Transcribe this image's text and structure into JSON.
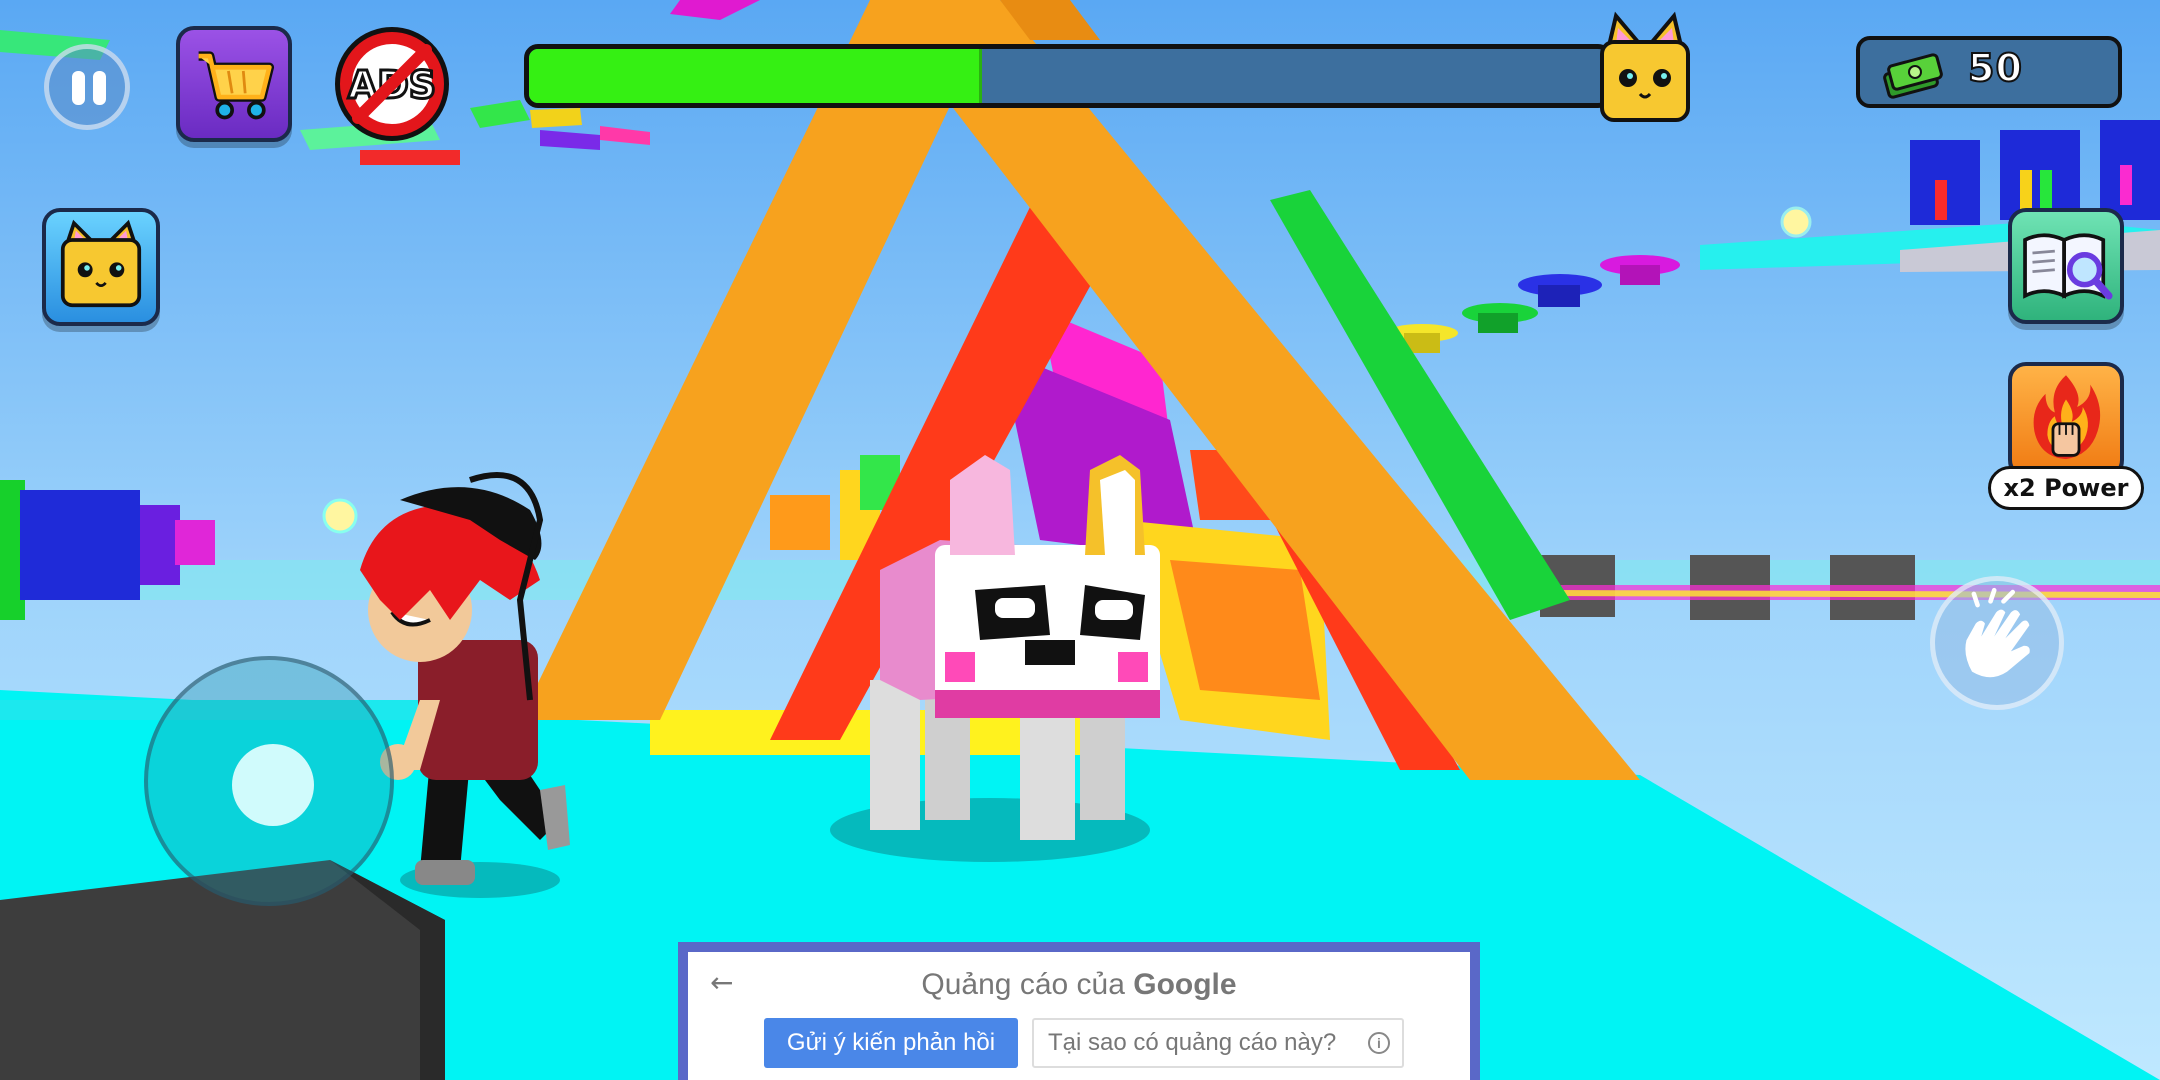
{
  "hud": {
    "progress_fraction": 0.42,
    "cash_value": "50",
    "power_label": "x2 Power",
    "noads_text": "ADS"
  },
  "ad_banner": {
    "title_prefix": "Quảng cáo của ",
    "title_brand": "Google",
    "feedback_button": "Gửi ý kiến phản hồi",
    "why_button": "Tại sao có quảng cáo này?",
    "info_glyph": "i",
    "back_glyph": "←"
  },
  "colors": {
    "sky": "#6fb6f5",
    "floor": "#00f5f5",
    "progress_fill": "#35f013",
    "progress_track": "#3d6f9e",
    "ad_frame": "#5a68c8",
    "ad_button": "#4a87e8"
  },
  "icons": [
    "pause-icon",
    "shopping-cart-icon",
    "no-ads-icon",
    "cat-pet-icon",
    "cash-icon",
    "book-magnifier-icon",
    "fire-fist-icon",
    "wave-hand-icon"
  ]
}
